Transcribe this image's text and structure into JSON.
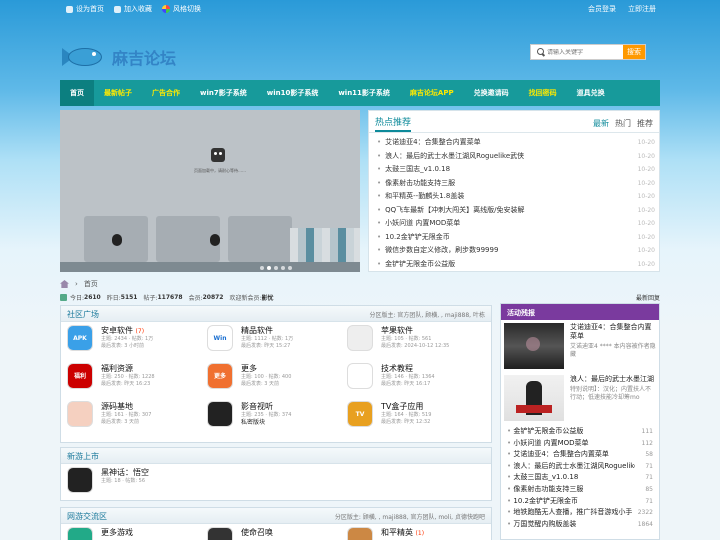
{
  "topbar": {
    "set_home": "设为首页",
    "add_fav": "加入收藏",
    "style_switch": "风格切换",
    "login": "会员登录",
    "register": "立即注册"
  },
  "site": {
    "name": "麻吉论坛"
  },
  "search": {
    "placeholder": "请输入关键字",
    "button": "搜索"
  },
  "nav": [
    "首页",
    "最新帖子",
    "广告合作",
    "win7影子系统",
    "win10影子系统",
    "win11影子系统",
    "麻吉论坛APP",
    "兑换邀请码",
    "找回密码",
    "道具兑换"
  ],
  "slider": {
    "caption": "页面加载中，请耐心等待……"
  },
  "hot": {
    "title": "热点推荐",
    "tabs": [
      "最新",
      "热门",
      "推荐"
    ],
    "items": [
      {
        "t": "艾诺迪亚4：合集整合内置菜单",
        "d": "10-20"
      },
      {
        "t": "浪人：最后的武士水墨江湖风Roguelike武侠",
        "d": "10-20"
      },
      {
        "t": "太鼓三国志_v1.0.18",
        "d": "10-20"
      },
      {
        "t": "像素射击功能支持三服",
        "d": "10-20"
      },
      {
        "t": "和平精英--勤麟头1.8盖装",
        "d": "10-20"
      },
      {
        "t": "QQ飞车最新【冲刺大闯关】离线版/免安装解",
        "d": "10-20"
      },
      {
        "t": "小妖问道 内置MOD菜单",
        "d": "10-20"
      },
      {
        "t": "10.2金铲铲无限金币",
        "d": "10-20"
      },
      {
        "t": "微信步数自定义修改，刷步数99999",
        "d": "10-20"
      },
      {
        "t": "金铲铲无限金币公益版",
        "d": "10-20"
      }
    ]
  },
  "crumb": {
    "home": "首页"
  },
  "stats": {
    "today_label": "今日:",
    "today": "2610",
    "yest_label": "昨日:",
    "yest": "5151",
    "posts_label": "帖子:",
    "posts": "117678",
    "members_label": "会员:",
    "members": "20872",
    "newest_label": "欢迎新会员:",
    "newest": "影忧",
    "latest": "最新回复"
  },
  "sections": [
    {
      "title": "社区广场",
      "mods": "分区版主: 官方团队, 顾横, , maji888, 叶栋",
      "forums": [
        {
          "name": "安卓软件",
          "count": "(7)",
          "l1": "主题: 2434 · 帖数: 1万",
          "l2": "最后发表: 3 小时前",
          "icon": "APK",
          "color": "#3aa0e8"
        },
        {
          "name": "精品软件",
          "count": "",
          "l1": "主题: 1112 · 帖数: 1万",
          "l2": "最后发表: 昨天 15:27",
          "icon": "Win",
          "color": "#fff"
        },
        {
          "name": "苹果软件",
          "count": "",
          "l1": "主题: 105 · 帖数: 561",
          "l2": "最后发表: 2024-10-12 12:35",
          "icon": "",
          "color": "#eee"
        },
        {
          "name": "福利资源",
          "count": "",
          "l1": "主题: 250 · 帖数: 1228",
          "l2": "最后发表: 昨天 16:23",
          "icon": "福利",
          "color": "#c00"
        },
        {
          "name": "更多",
          "count": "",
          "l1": "主题: 100 · 帖数: 400",
          "l2": "最后发表: 3 天前",
          "icon": "更多",
          "color": "#f07030"
        },
        {
          "name": "技术教程",
          "count": "",
          "l1": "主题: 146 · 帖数: 1364",
          "l2": "最后发表: 昨天 16:17",
          "icon": "",
          "color": "#fff"
        },
        {
          "name": "源码基地",
          "count": "",
          "l1": "主题: 161 · 帖数: 307",
          "l2": "最后发表: 3 天前",
          "icon": "",
          "color": "#f5d0c0"
        },
        {
          "name": "影音视听",
          "count": "",
          "l1": "主题: 235 · 帖数: 374",
          "l2": "私密版块",
          "icon": "",
          "color": "#222"
        },
        {
          "name": "TV盒子应用",
          "count": "",
          "l1": "主题: 164 · 帖数: 519",
          "l2": "最后发表: 昨天 12:32",
          "icon": "TV",
          "color": "#e8a020"
        }
      ]
    },
    {
      "title": "新游上市",
      "mods": "",
      "forums": [
        {
          "name": "黑神话：悟空",
          "count": "",
          "l1": "主题: 18 · 帖数: 56",
          "l2": "",
          "icon": "",
          "color": "#222"
        }
      ]
    },
    {
      "title": "网游交流区",
      "mods": "分区版主: 顾横, , maji888, 官方团队, moli, 贞德快跑吧",
      "forums": [
        {
          "name": "更多游戏",
          "count": "",
          "l1": "",
          "l2": "",
          "icon": "",
          "color": "#2a8"
        },
        {
          "name": "使命召唤",
          "count": "",
          "l1": "",
          "l2": "",
          "icon": "",
          "color": "#333"
        },
        {
          "name": "和平精英",
          "count": "(1)",
          "l1": "",
          "l2": "",
          "icon": "",
          "color": "#c84"
        }
      ]
    }
  ],
  "right": {
    "title": "活动残报",
    "feature": [
      {
        "t": "艾诺迪亚4：合集整合内置菜单",
        "s": "艾诺迪亚4 **** 本内容被作者隐藏"
      },
      {
        "t": "浪人：最后的武士水墨江湖",
        "s": "特别说明】：汉化；内置扶人不行动；低速技能冷却筹mo"
      }
    ],
    "list": [
      {
        "t": "金铲铲无限金币公益版",
        "c": "111"
      },
      {
        "t": "小妖问道 内置MOD菜单",
        "c": "112"
      },
      {
        "t": "艾诺迪亚4：合集整合内置菜单",
        "c": "58"
      },
      {
        "t": "浪人：最后的武士水墨江湖风Roguelike武侠",
        "c": "71"
      },
      {
        "t": "太鼓三国志_v1.0.18",
        "c": "71"
      },
      {
        "t": "像素射击功能支持三服",
        "c": "85"
      },
      {
        "t": "10.2金铲铲无限金币",
        "c": "71"
      },
      {
        "t": "地铁跑酷无人查播，推广抖音游戏小手",
        "c": "2322"
      },
      {
        "t": "万国觉醒内购版盖装",
        "c": "1864"
      }
    ]
  }
}
